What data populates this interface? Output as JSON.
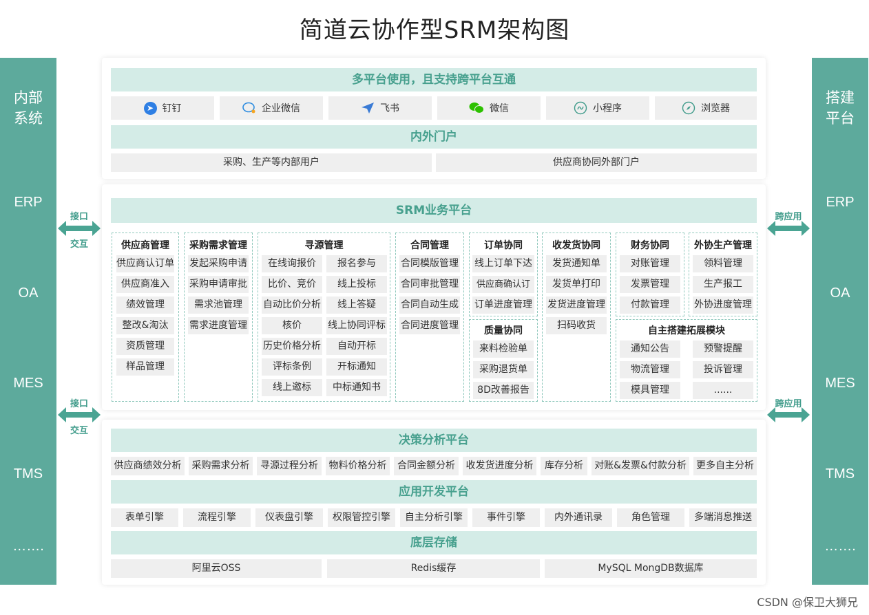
{
  "title": "简道云协作型SRM架构图",
  "left_sidebar": {
    "heading": [
      "内部",
      "系统"
    ],
    "items": [
      "ERP",
      "OA",
      "MES",
      "TMS",
      "……."
    ]
  },
  "right_sidebar": {
    "heading": [
      "搭建",
      "平台"
    ],
    "items": [
      "ERP",
      "OA",
      "MES",
      "TMS",
      "……."
    ]
  },
  "connectors": {
    "left_top": [
      "接口",
      "交互"
    ],
    "left_bottom": [
      "接口",
      "交互"
    ],
    "right_top": "跨应用",
    "right_bottom": "跨应用"
  },
  "top_panel": {
    "multi_platform": "多平台使用，且支持跨平台互通",
    "platforms": [
      {
        "label": "钉钉",
        "icon": "dingtalk-icon"
      },
      {
        "label": "企业微信",
        "icon": "wecom-icon"
      },
      {
        "label": "飞书",
        "icon": "feishu-icon"
      },
      {
        "label": "微信",
        "icon": "wechat-icon"
      },
      {
        "label": "小程序",
        "icon": "mini-program-icon"
      },
      {
        "label": "浏览器",
        "icon": "browser-icon"
      }
    ],
    "portal": "内外门户",
    "portal_items": [
      "采购、生产等内部用户",
      "供应商协同外部门户"
    ]
  },
  "srm": {
    "title": "SRM业务平台",
    "modules": {
      "supplier": {
        "title": "供应商管理",
        "items": [
          "供应商认订单",
          "供应商准入",
          "绩效管理",
          "整改&淘汰",
          "资质管理",
          "样品管理"
        ]
      },
      "demand": {
        "title": "采购需求管理",
        "items": [
          "发起采购申请",
          "采购申请审批",
          "需求池管理",
          "需求进度管理"
        ]
      },
      "sourcing": {
        "title": "寻源管理",
        "left": [
          "在线询报价",
          "比价、竞价",
          "自动比价分析",
          "核价",
          "历史价格分析",
          "评标条例",
          "线上邀标"
        ],
        "right": [
          "报名参与",
          "线上投标",
          "线上答疑",
          "线上协同评标",
          "自动开标",
          "开标通知",
          "中标通知书"
        ]
      },
      "contract": {
        "title": "合同管理",
        "items": [
          "合同模版管理",
          "合同审批管理",
          "合同自动生成",
          "合同进度管理"
        ]
      },
      "order": {
        "title": "订单协同",
        "items": [
          "线上订单下达",
          "供应商确认订单",
          "订单进度管理"
        ]
      },
      "quality": {
        "title": "质量协同",
        "items": [
          "来料检验单",
          "采购退货单",
          "8D改善报告"
        ]
      },
      "delivery": {
        "title": "收发货协同",
        "items": [
          "发货通知单",
          "发货单打印",
          "发货进度管理",
          "扫码收货"
        ]
      },
      "finance": {
        "title": "财务协同",
        "items": [
          "对账管理",
          "发票管理",
          "付款管理"
        ]
      },
      "outsource": {
        "title": "外协生产管理",
        "items": [
          "领料管理",
          "生产报工",
          "外协进度管理"
        ]
      },
      "custom": {
        "title": "自主搭建拓展模块",
        "left": [
          "通知公告",
          "物流管理",
          "模具管理"
        ],
        "right": [
          "预警提醒",
          "投诉管理",
          "......"
        ]
      }
    }
  },
  "bottom_panel": {
    "decision": "决策分析平台",
    "decision_items": [
      "供应商绩效分析",
      "采购需求分析",
      "寻源过程分析",
      "物料价格分析",
      "合同金额分析",
      "收发货进度分析",
      "库存分析",
      "对账&发票&付款分析",
      "更多自主分析"
    ],
    "appdev": "应用开发平台",
    "appdev_items": [
      "表单引擎",
      "流程引擎",
      "仪表盘引擎",
      "权限管控引擎",
      "自主分析引擎",
      "事件引擎",
      "内外通讯录",
      "角色管理",
      "多端消息推送"
    ],
    "storage": "底层存储",
    "storage_items": [
      "阿里云OSS",
      "Redis缓存",
      "MySQL MongDB数据库"
    ]
  },
  "watermark": "CSDN @保卫大狮兄",
  "colors": {
    "teal": "#5daa9c",
    "band_bg": "#d4ece7",
    "band_text": "#47a08e",
    "cell_bg": "#efefef",
    "dashed": "#8fc8bc"
  }
}
